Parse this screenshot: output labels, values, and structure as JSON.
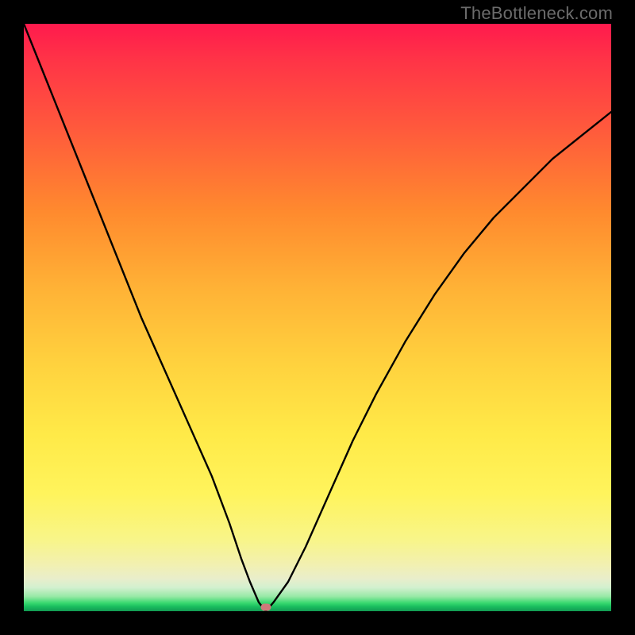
{
  "watermark": "TheBottleneck.com",
  "chart_data": {
    "type": "line",
    "title": "",
    "xlabel": "",
    "ylabel": "",
    "xlim": [
      0,
      100
    ],
    "ylim": [
      0,
      100
    ],
    "grid": false,
    "legend": false,
    "gradient_stops": [
      {
        "pct": 0,
        "color": "#ff1a4d"
      },
      {
        "pct": 18,
        "color": "#ff5a3c"
      },
      {
        "pct": 45,
        "color": "#ffb236"
      },
      {
        "pct": 70,
        "color": "#ffea48"
      },
      {
        "pct": 92,
        "color": "#f2f0b0"
      },
      {
        "pct": 97,
        "color": "#97e9a6"
      },
      {
        "pct": 100,
        "color": "#129a52"
      }
    ],
    "series": [
      {
        "name": "bottleneck-curve",
        "x": [
          0,
          4,
          8,
          12,
          16,
          20,
          24,
          28,
          32,
          35,
          37,
          38.5,
          40,
          41.2,
          42.5,
          45,
          48,
          52,
          56,
          60,
          65,
          70,
          75,
          80,
          85,
          90,
          95,
          100
        ],
        "y": [
          100,
          90,
          80,
          70,
          60,
          50,
          41,
          32,
          23,
          15,
          9,
          5,
          1.5,
          0,
          1.5,
          5,
          11,
          20,
          29,
          37,
          46,
          54,
          61,
          67,
          72,
          77,
          81,
          85
        ]
      }
    ],
    "marker": {
      "x": 41.2,
      "y": 0.7,
      "color": "#cf7a7a"
    }
  }
}
